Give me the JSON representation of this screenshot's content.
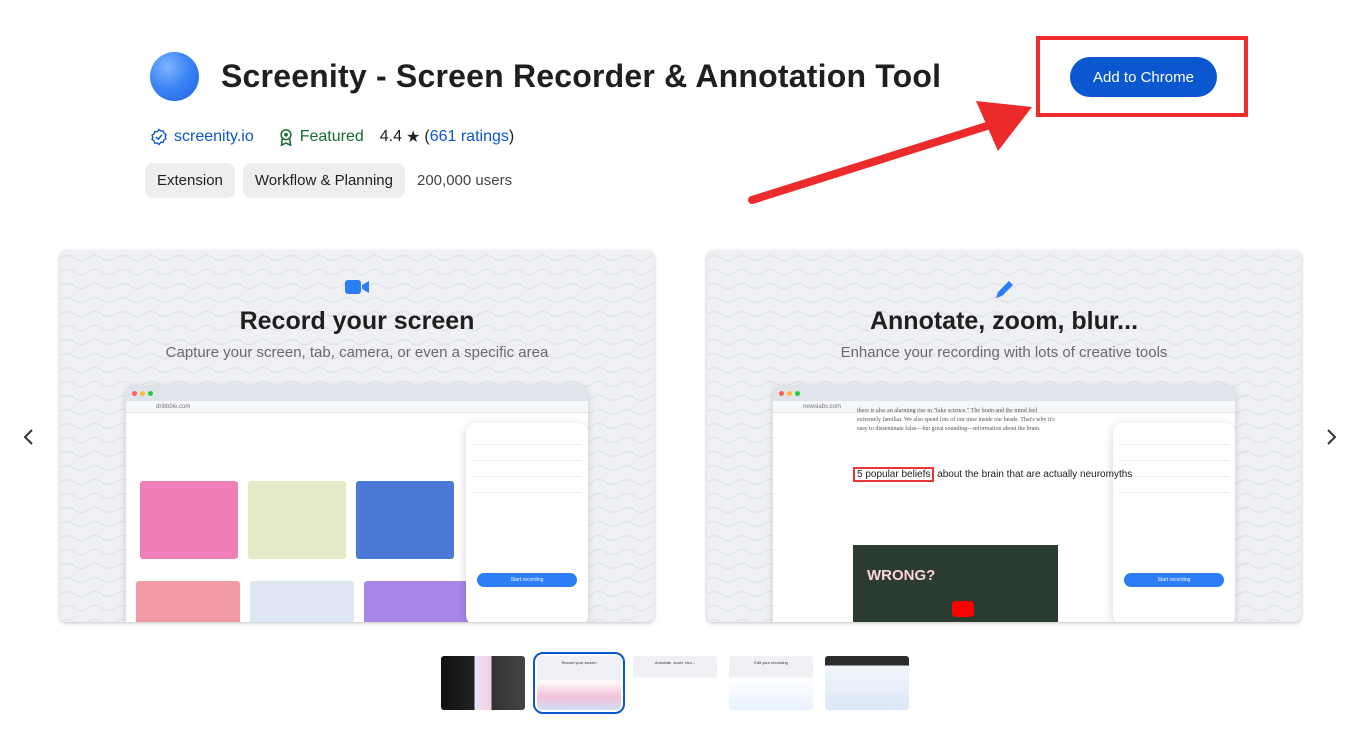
{
  "header": {
    "title": "Screenity - Screen Recorder & Annotation Tool",
    "add_button": "Add to Chrome",
    "site": "screenity.io",
    "featured": "Featured",
    "rating": "4.4",
    "rating_star": "★",
    "ratings_link": "661 ratings",
    "paren_open": "(",
    "paren_close": ")"
  },
  "chips": {
    "type": "Extension",
    "category": "Workflow & Planning",
    "users": "200,000 users"
  },
  "colors": {
    "accent": "#0b57d0",
    "featured_green": "#146c2e",
    "annotation_red": "#ee2b2b",
    "brand_blue": "#2d7df6"
  },
  "carousel": {
    "prev_icon": "chevron-left-icon",
    "next_icon": "chevron-right-icon",
    "slides": [
      {
        "icon": "video-camera-icon",
        "title": "Record your screen",
        "subtitle": "Capture your screen, tab, camera, or even a specific area",
        "mock_url": "dribbble.com",
        "mock_button": "Start recording"
      },
      {
        "icon": "pencil-icon",
        "title": "Annotate, zoom, blur...",
        "subtitle": "Enhance your recording with lots of creative tools",
        "mock_url": "newslabs.com",
        "mock_button": "Start recording",
        "article_text": "there is also an alarming rise in \"fake science.\" The brain and the mind feel extremely familiar. We also spend lots of our time inside our heads. That's why it's easy to disseminate false—but great sounding—information about the brain.",
        "popular_boxed": "5 popular beliefs",
        "popular_rest": " about the brain that are actually neuromyths",
        "wrong_label": "WRONG?"
      }
    ]
  },
  "thumbnails": [
    {
      "label": ""
    },
    {
      "label": "Record your screen"
    },
    {
      "label": "Annotate, zoom, blur..."
    },
    {
      "label": "Edit your recording"
    },
    {
      "label": ""
    }
  ]
}
